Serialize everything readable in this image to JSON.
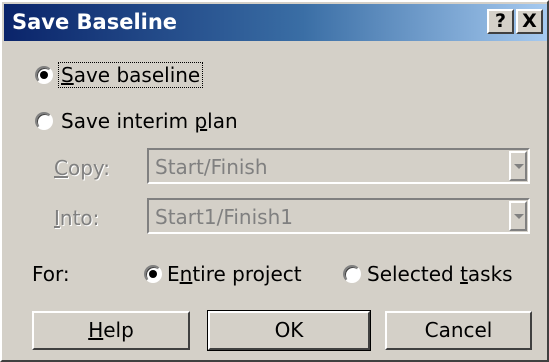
{
  "window": {
    "title": "Save Baseline",
    "help_button": "?",
    "close_button": "X"
  },
  "options": {
    "save_baseline": {
      "label_pre": "",
      "label_ul": "S",
      "label_post": "ave baseline",
      "checked": true
    },
    "save_interim": {
      "label_pre": "Save interim ",
      "label_ul": "p",
      "label_post": "lan",
      "checked": false
    }
  },
  "copy": {
    "label_ul": "C",
    "label_post": "opy:",
    "value": "Start/Finish"
  },
  "into": {
    "label_ul": "I",
    "label_post": "nto:",
    "value": "Start1/Finish1"
  },
  "for": {
    "label": "For:",
    "entire_project": {
      "label_pre": "E",
      "label_ul": "n",
      "label_post": "tire project",
      "checked": true
    },
    "selected_tasks": {
      "label_pre": "Selected ",
      "label_ul": "t",
      "label_post": "asks",
      "checked": false
    }
  },
  "buttons": {
    "help": {
      "label_ul": "H",
      "label_post": "elp"
    },
    "ok": "OK",
    "cancel": "Cancel"
  }
}
